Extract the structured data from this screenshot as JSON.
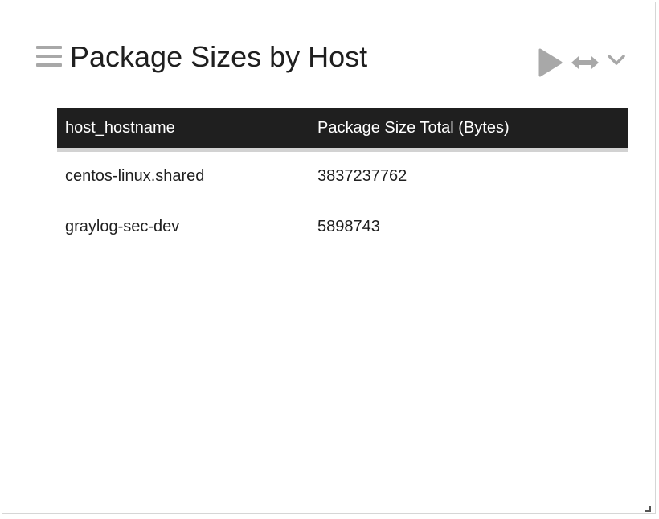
{
  "widget": {
    "title": "Package Sizes by Host",
    "icons": {
      "drag": "hamburger-icon",
      "replay": "play-icon",
      "expand": "horizontal-arrows-icon",
      "menu": "chevron-down-icon"
    },
    "colors": {
      "header_bg": "#1f1f1f",
      "header_text": "#ffffff",
      "icon_gray": "#a8a8a8",
      "text": "#1f1f1f"
    }
  },
  "table": {
    "columns": [
      "host_hostname",
      "Package Size Total (Bytes)"
    ],
    "rows": [
      [
        "centos-linux.shared",
        "3837237762"
      ],
      [
        "graylog-sec-dev",
        "5898743"
      ]
    ]
  }
}
